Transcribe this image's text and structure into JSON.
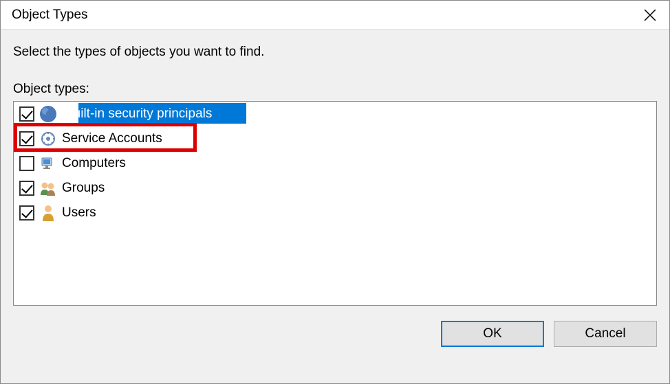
{
  "title": "Object Types",
  "instruction": "Select the types of objects you want to find.",
  "list_label": "Object types:",
  "rows": [
    {
      "label": "Built-in security principals",
      "checked": true,
      "selected": true,
      "icon": "principals-icon"
    },
    {
      "label": "Service Accounts",
      "checked": true,
      "selected": false,
      "icon": "service-account-icon",
      "highlighted": true
    },
    {
      "label": "Computers",
      "checked": false,
      "selected": false,
      "icon": "computer-icon"
    },
    {
      "label": "Groups",
      "checked": true,
      "selected": false,
      "icon": "group-icon"
    },
    {
      "label": "Users",
      "checked": true,
      "selected": false,
      "icon": "user-icon"
    }
  ],
  "buttons": {
    "ok": "OK",
    "cancel": "Cancel"
  }
}
